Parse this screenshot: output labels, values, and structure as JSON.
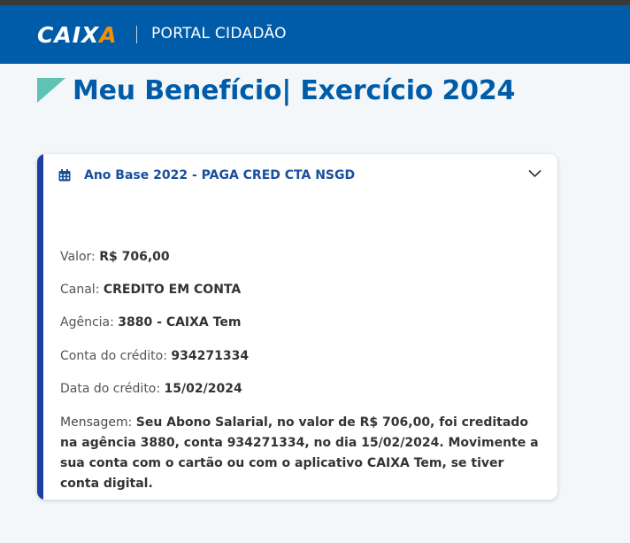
{
  "header": {
    "logo_text_main": "CAIX",
    "logo_text_accent": "A",
    "portal_title": "PORTAL CIDADÃO"
  },
  "page": {
    "title": "Meu Benefício| Exercício 2024"
  },
  "benefit_card": {
    "header_label": "Ano Base 2022 - PAGA CRED CTA NSGD",
    "fields": {
      "valor": {
        "label": "Valor:",
        "value": "R$ 706,00"
      },
      "canal": {
        "label": "Canal:",
        "value": "CREDITO EM CONTA"
      },
      "agencia": {
        "label": "Agência:",
        "value": "3880 - CAIXA Tem"
      },
      "conta": {
        "label": "Conta do crédito:",
        "value": "934271334"
      },
      "data": {
        "label": "Data do crédito:",
        "value": "15/02/2024"
      },
      "mensagem": {
        "label": "Mensagem:",
        "value": "Seu Abono Salarial, no valor de R$ 706,00, foi creditado na agência 3880, conta 934271334, no dia 15/02/2024. Movimente a sua conta com o cartão ou com o aplicativo CAIXA Tem, se tiver conta digital."
      }
    }
  },
  "colors": {
    "header_bg": "#005ca9",
    "logo_accent": "#f39200",
    "title_color": "#005ca9",
    "flag_color": "#5ec3b3",
    "card_accent": "#1f3f9f"
  },
  "icons": {
    "card_header_icon": "calendar-icon",
    "card_toggle_icon": "chevron-down-icon",
    "title_decoration": "flag-triangle-icon"
  }
}
